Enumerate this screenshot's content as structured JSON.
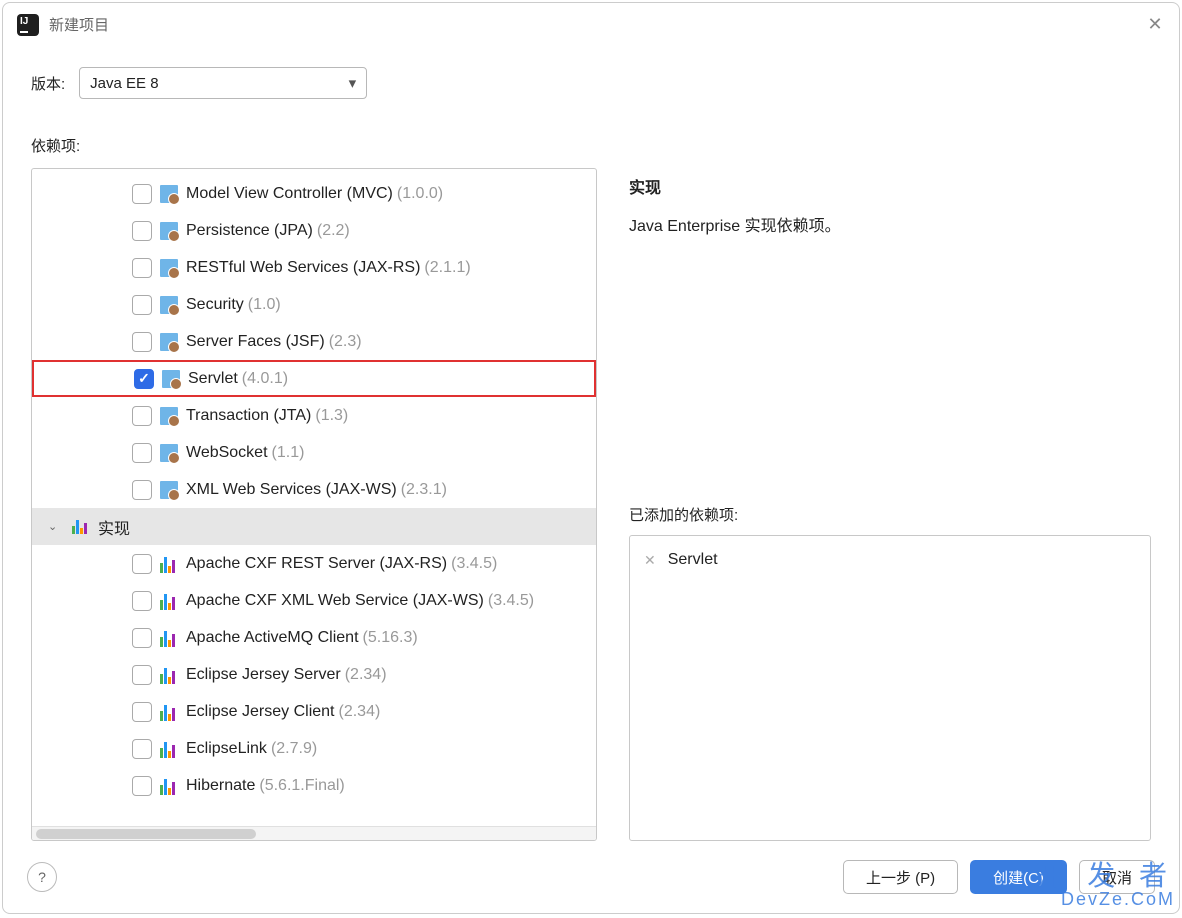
{
  "dialog": {
    "title": "新建项目"
  },
  "version": {
    "label": "版本:",
    "value": "Java EE 8"
  },
  "dependencies": {
    "label": "依赖项:",
    "items": [
      {
        "type": "spec",
        "checked": false,
        "label": "Model View Controller (MVC)",
        "version": "(1.0.0)"
      },
      {
        "type": "spec",
        "checked": false,
        "label": "Persistence (JPA)",
        "version": "(2.2)"
      },
      {
        "type": "spec",
        "checked": false,
        "label": "RESTful Web Services (JAX-RS)",
        "version": "(2.1.1)"
      },
      {
        "type": "spec",
        "checked": false,
        "label": "Security",
        "version": "(1.0)"
      },
      {
        "type": "spec",
        "checked": false,
        "label": "Server Faces (JSF)",
        "version": "(2.3)"
      },
      {
        "type": "spec",
        "checked": true,
        "label": "Servlet",
        "version": "(4.0.1)",
        "highlight": true
      },
      {
        "type": "spec",
        "checked": false,
        "label": "Transaction (JTA)",
        "version": "(1.3)"
      },
      {
        "type": "spec",
        "checked": false,
        "label": "WebSocket",
        "version": "(1.1)"
      },
      {
        "type": "spec",
        "checked": false,
        "label": "XML Web Services (JAX-WS)",
        "version": "(2.3.1)"
      },
      {
        "type": "group",
        "label": "实现"
      },
      {
        "type": "impl",
        "checked": false,
        "label": "Apache CXF REST Server (JAX-RS)",
        "version": "(3.4.5)"
      },
      {
        "type": "impl",
        "checked": false,
        "label": "Apache CXF XML Web Service (JAX-WS)",
        "version": "(3.4.5)"
      },
      {
        "type": "impl",
        "checked": false,
        "label": "Apache ActiveMQ Client",
        "version": "(5.16.3)"
      },
      {
        "type": "impl",
        "checked": false,
        "label": "Eclipse Jersey Server",
        "version": "(2.34)"
      },
      {
        "type": "impl",
        "checked": false,
        "label": "Eclipse Jersey Client",
        "version": "(2.34)"
      },
      {
        "type": "impl",
        "checked": false,
        "label": "EclipseLink",
        "version": "(2.7.9)"
      },
      {
        "type": "impl",
        "checked": false,
        "label": "Hibernate",
        "version": "(5.6.1.Final)"
      }
    ]
  },
  "detail": {
    "title": "实现",
    "description": "Java Enterprise 实现依赖项。"
  },
  "added": {
    "label": "已添加的依赖项:",
    "items": [
      {
        "label": "Servlet"
      }
    ]
  },
  "footer": {
    "back": "上一步 (P)",
    "create": "创建(C)",
    "cancel": "取消"
  },
  "watermark": {
    "line1": "开 发 者",
    "line2": "DevZe.CoM"
  }
}
